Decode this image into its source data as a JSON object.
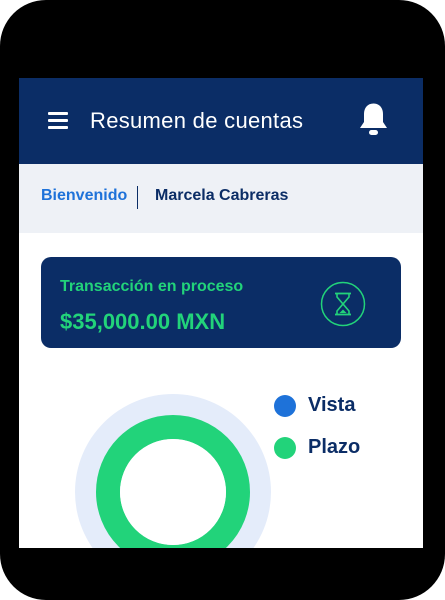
{
  "app_bar": {
    "title": "Resumen de cuentas"
  },
  "welcome": {
    "label": "Bienvenido",
    "user_name": "Marcela Cabreras"
  },
  "transaction": {
    "label": "Transacción en proceso",
    "amount": "$35,000.00 MXN"
  },
  "legend": [
    {
      "label": "Vista",
      "color": "#1e72d9"
    },
    {
      "label": "Plazo",
      "color": "#22d37a"
    }
  ],
  "colors": {
    "primary": "#0b2d66",
    "accent_green": "#22d37a",
    "accent_blue": "#1e72d9",
    "donut_track": "#e4ecfa"
  },
  "icons": [
    "menu-icon",
    "bell-icon",
    "hourglass-icon"
  ]
}
